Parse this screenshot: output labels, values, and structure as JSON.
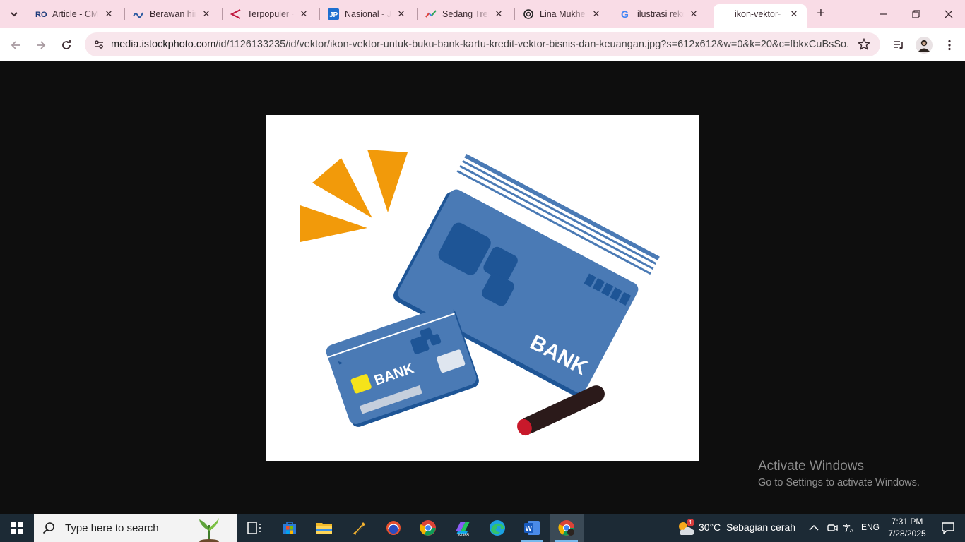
{
  "browser": {
    "tabs": [
      {
        "title": "Article - CMS",
        "favicon": "ro-logo-icon",
        "active": false
      },
      {
        "title": "Berawan hingga",
        "favicon": "news-wave-icon",
        "active": false
      },
      {
        "title": "Terpopuler - ",
        "favicon": "triangle-logo-icon",
        "active": false
      },
      {
        "title": "Nasional - Ja",
        "favicon": "jp-logo-icon",
        "active": false
      },
      {
        "title": "Sedang Tren",
        "favicon": "trends-icon",
        "active": false
      },
      {
        "title": "Lina Mukher",
        "favicon": "chatgpt-icon",
        "active": false
      },
      {
        "title": "ilustrasi reke",
        "favicon": "google-icon",
        "active": false
      },
      {
        "title": "ikon-vektor-",
        "favicon": "none",
        "active": true
      }
    ],
    "url_host": "media.istockphoto.com",
    "url_path": "/id/1126133235/id/vektor/ikon-vektor-untuk-buku-bank-kartu-kredit-vektor-bisnis-dan-keuangan.jpg?s=612x612&w=0&k=20&c=fbkxCuBsSo...",
    "accent_color": "#f9dce6"
  },
  "image": {
    "card_label_large": "BANK",
    "card_label_small": "BANK",
    "colors": {
      "card": "#4a7ab5",
      "card_dark": "#1e5596",
      "burst": "#f29a0a",
      "chip": "#f5e31a",
      "seal": "#2b1a1a",
      "seal_tip": "#c8192b"
    }
  },
  "watermark": {
    "line1": "Activate Windows",
    "line2": "Go to Settings to activate Windows."
  },
  "taskbar": {
    "search_placeholder": "Type here to search",
    "weather_temp": "30°C",
    "weather_desc": "Sebagian cerah",
    "weather_badge": "1",
    "language": "ENG",
    "time": "7:31 PM",
    "date": "7/28/2025"
  }
}
